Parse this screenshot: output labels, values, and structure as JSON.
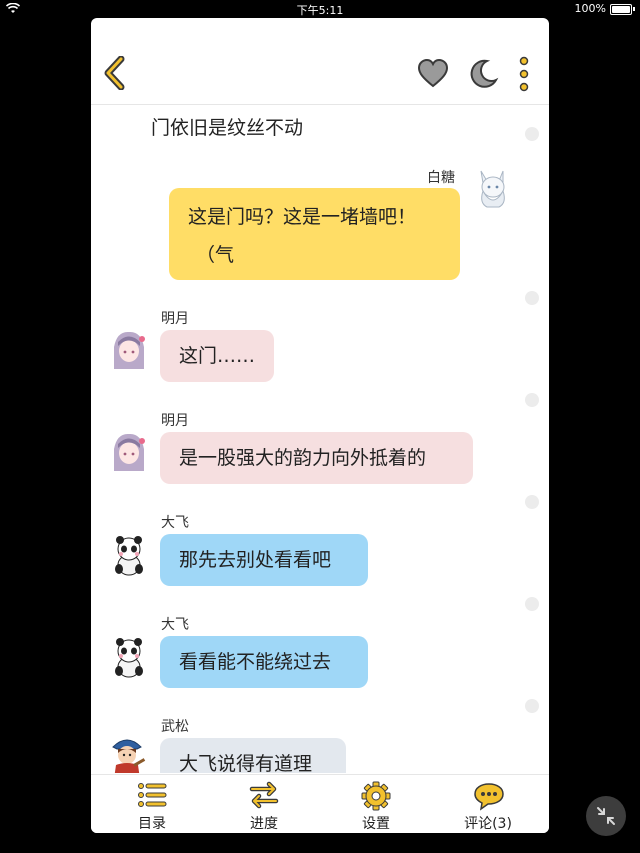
{
  "status_bar": {
    "time": "下午5:11",
    "battery": "100%"
  },
  "colors": {
    "accent": "#f2c12e",
    "yellow_bubble": "#ffdd66",
    "pink_bubble": "#f6dfe0",
    "blue_bubble": "#9fd7f7",
    "gray_bubble": "#e3e8ee"
  },
  "toolbar": {
    "back_icon": "chevron-left-icon",
    "like_icon": "heart-icon",
    "night_icon": "moon-icon",
    "more_icon": "more-vertical-icon"
  },
  "narration": "门依旧是纹丝不动",
  "messages": [
    {
      "speaker": "白糖",
      "text_lines": [
        "这是门吗？这是一堵墙吧！",
        "（气"
      ],
      "side": "right",
      "bubble": "yellow"
    },
    {
      "speaker": "明月",
      "text": "这门……",
      "side": "left",
      "bubble": "pink"
    },
    {
      "speaker": "明月",
      "text": "是一股强大的韵力向外抵着的",
      "side": "left",
      "bubble": "pink"
    },
    {
      "speaker": "大飞",
      "text": "那先去别处看看吧",
      "side": "left",
      "bubble": "blue"
    },
    {
      "speaker": "大飞",
      "text": "看看能不能绕过去",
      "side": "left",
      "bubble": "blue"
    },
    {
      "speaker": "武松",
      "text": "大飞说得有道理",
      "side": "left",
      "bubble": "gray"
    }
  ],
  "bottom_nav": [
    {
      "label": "目录",
      "icon": "list-icon"
    },
    {
      "label": "进度",
      "icon": "swap-arrows-icon"
    },
    {
      "label": "设置",
      "icon": "gear-icon"
    },
    {
      "label": "评论(3)",
      "icon": "chat-bubble-icon"
    }
  ],
  "floating_button": {
    "icon": "collapse-arrows-icon"
  }
}
